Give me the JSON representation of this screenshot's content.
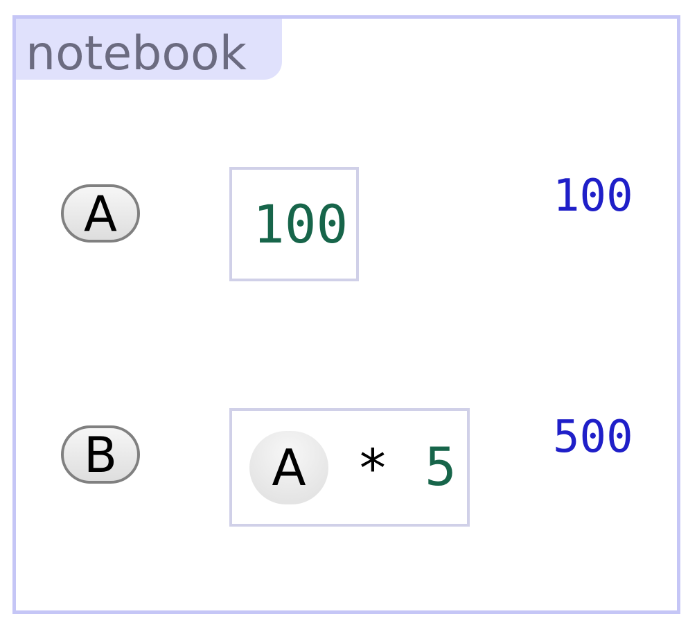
{
  "notebook": {
    "title": "notebook"
  },
  "cells": [
    {
      "variable": "A",
      "expression": {
        "value": "100"
      },
      "result": "100"
    },
    {
      "variable": "B",
      "expression": {
        "ref": "A",
        "operator": "*",
        "value": "5"
      },
      "result": "500"
    }
  ],
  "colors": {
    "border": "#c5c6f6",
    "tab_background": "#e0e1fc",
    "number": "#17654a",
    "result": "#1f1fc8",
    "cell_border": "#d0d0e8"
  }
}
